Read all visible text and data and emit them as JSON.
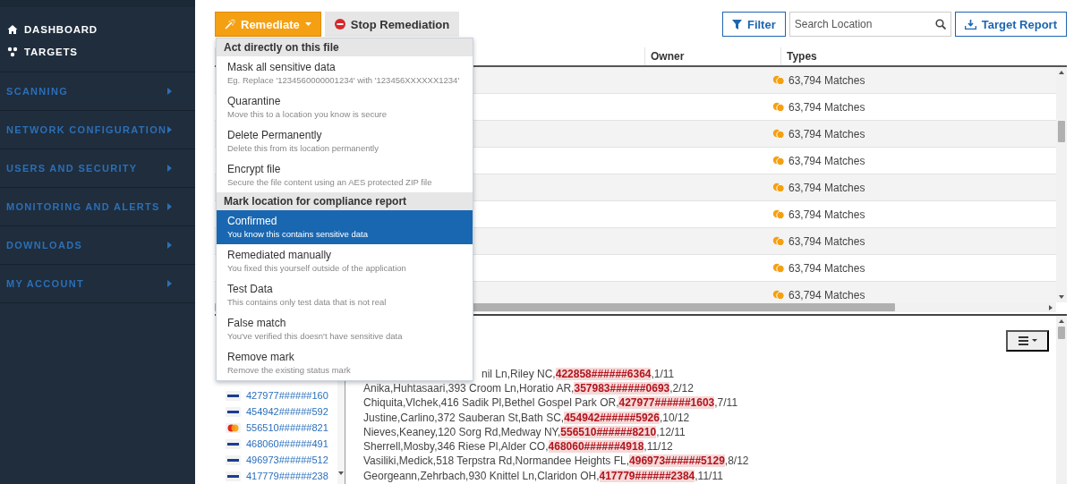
{
  "sidebar": {
    "items": [
      {
        "label": "DASHBOARD",
        "kind": "top"
      },
      {
        "label": "TARGETS",
        "kind": "top"
      },
      {
        "label": "SCANNING",
        "kind": "section"
      },
      {
        "label": "NETWORK CONFIGURATION",
        "kind": "section"
      },
      {
        "label": "USERS AND SECURITY",
        "kind": "section"
      },
      {
        "label": "MONITORING AND ALERTS",
        "kind": "section"
      },
      {
        "label": "DOWNLOADS",
        "kind": "section"
      },
      {
        "label": "MY ACCOUNT",
        "kind": "section"
      }
    ]
  },
  "toolbar": {
    "remediate": "Remediate",
    "stop": "Stop Remediation",
    "filter": "Filter",
    "search": {
      "placeholder": "Search Location"
    },
    "report": "Target Report"
  },
  "remediate_menu": {
    "sections": [
      {
        "header": "Act directly on this file",
        "items": [
          {
            "title": "Mask all sensitive data",
            "description": "Eg. Replace '1234560000001234' with '123456XXXXXX1234'",
            "selected": false
          },
          {
            "title": "Quarantine",
            "description": "Move this to a location you know is secure",
            "selected": false
          },
          {
            "title": "Delete Permanently",
            "description": "Delete this from its location permanently",
            "selected": false
          },
          {
            "title": "Encrypt file",
            "description": "Secure the file content using an AES protected ZIP file",
            "selected": false
          }
        ]
      },
      {
        "header": "Mark location for compliance report",
        "items": [
          {
            "title": "Confirmed",
            "description": "You know this contains sensitive data",
            "selected": true
          },
          {
            "title": "Remediated manually",
            "description": "You fixed this yourself outside of the application",
            "selected": false
          },
          {
            "title": "Test Data",
            "description": "This contains only test data that is not real",
            "selected": false
          },
          {
            "title": "False match",
            "description": "You've verified this doesn't have sensitive data",
            "selected": false
          },
          {
            "title": "Remove mark",
            "description": "Remove the existing status mark",
            "selected": false
          }
        ]
      }
    ]
  },
  "table": {
    "columns": [
      "Owner",
      "Types"
    ],
    "rows": [
      {
        "types": "63,794 Matches"
      },
      {
        "types": "63,794 Matches"
      },
      {
        "types": "63,794 Matches"
      },
      {
        "types": "63,794 Matches"
      },
      {
        "types": "63,794 Matches"
      },
      {
        "types": "63,794 Matches"
      },
      {
        "types": "63,794 Matches"
      },
      {
        "types": "63,794 Matches"
      },
      {
        "types": "63,794 Matches"
      }
    ]
  },
  "cards": [
    {
      "number": "427977######160",
      "kind": "visa"
    },
    {
      "number": "454942######592",
      "kind": "visa"
    },
    {
      "number": "556510######821",
      "kind": "mastercard"
    },
    {
      "number": "468060######491",
      "kind": "visa"
    },
    {
      "number": "496973######512",
      "kind": "visa"
    },
    {
      "number": "417779######238",
      "kind": "visa"
    }
  ],
  "file_lines": [
    {
      "text": "nil Ln,Riley NC,",
      "match": "422858######6364",
      "after": ",1/11",
      "cut_start": true
    },
    {
      "text": "Anika,Huhtasaari,393 Croom Ln,Horatio AR,",
      "match": "357983######0693",
      "after": ",2/12"
    },
    {
      "text": "Chiquita,Vlchek,416 Sadik Pl,Bethel Gospel Park OR,",
      "match": "427977######1603",
      "after": ",7/11"
    },
    {
      "text": "Justine,Carlino,372 Sauberan St,Bath SC,",
      "match": "454942######5926",
      "after": ",10/12"
    },
    {
      "text": "Nieves,Keaney,120 Sorg Rd,Medway NY,",
      "match": "556510######8210",
      "after": ",12/11"
    },
    {
      "text": "Sherrell,Mosby,346 Riese Pl,Alder CO,",
      "match": "468060######4918",
      "after": ",11/12"
    },
    {
      "text": "Vasiliki,Medick,518 Terpstra Rd,Normandee Heights FL,",
      "match": "496973######5129",
      "after": ",8/12"
    },
    {
      "text": "Georgeann,Zehrbach,930 Knittel Ln,Claridon OH,",
      "match": "417779######2384",
      "after": ",11/11"
    }
  ]
}
